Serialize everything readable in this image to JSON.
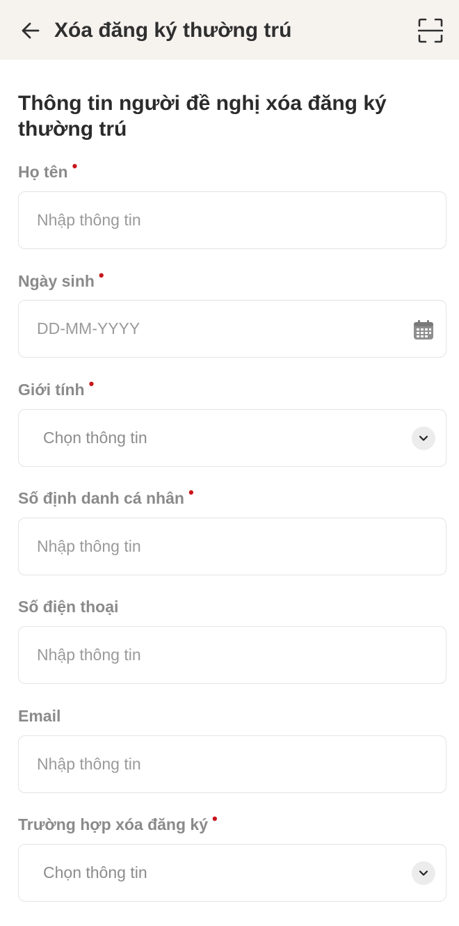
{
  "header": {
    "title": "Xóa đăng ký thường trú",
    "back_icon": "arrow-left-icon",
    "scan_icon": "scan-frame-icon"
  },
  "section": {
    "title": "Thông tin người đề nghị xóa đăng ký thường trú"
  },
  "form": {
    "required_mark": "•",
    "full_name": {
      "label": "Họ tên",
      "placeholder": "Nhập thông tin"
    },
    "birth_date": {
      "label": "Ngày sinh",
      "placeholder": "DD-MM-YYYY",
      "icon": "calendar-icon"
    },
    "gender": {
      "label": "Giới tính",
      "value": "Chọn thông tin",
      "icon": "chevron-down-icon"
    },
    "personal_id": {
      "label": "Số định danh cá nhân",
      "placeholder": "Nhập thông tin"
    },
    "phone": {
      "label": "Số điện thoại",
      "placeholder": "Nhập thông tin"
    },
    "email": {
      "label": "Email",
      "placeholder": "Nhập thông tin"
    },
    "removal_case": {
      "label": "Trường hợp xóa đăng ký",
      "value": "Chọn thông tin",
      "icon": "chevron-down-icon"
    }
  },
  "colors": {
    "header_bg": "#f6f3ef",
    "required": "#c8151b",
    "label": "#8a8a8a",
    "border": "#e3e3e3"
  }
}
